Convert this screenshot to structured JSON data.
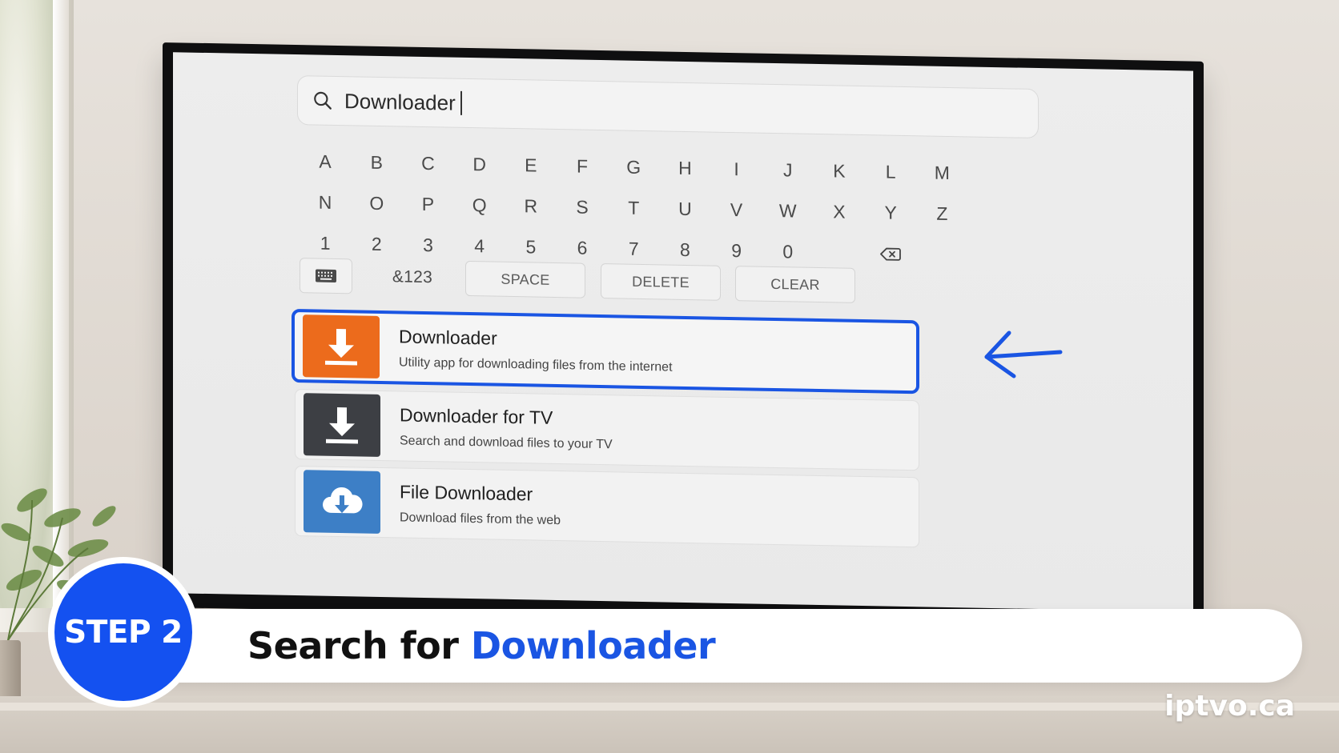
{
  "search": {
    "query": "Downloader"
  },
  "keyboard": {
    "rows": [
      [
        "A",
        "B",
        "C",
        "D",
        "E",
        "F",
        "G",
        "H",
        "I",
        "J",
        "K",
        "L",
        "M"
      ],
      [
        "N",
        "O",
        "P",
        "Q",
        "R",
        "S",
        "T",
        "U",
        "V",
        "W",
        "X",
        "Y",
        "Z"
      ],
      [
        "1",
        "2",
        "3",
        "4",
        "5",
        "6",
        "7",
        "8",
        "9",
        "0"
      ]
    ],
    "backspace_icon": "backspace-icon",
    "actions": {
      "keyboard_icon": "keyboard-icon",
      "symbols": "&123",
      "space": "SPACE",
      "delete": "DELETE",
      "clear": "CLEAR"
    }
  },
  "results": [
    {
      "title": "Downloader",
      "subtitle": "Utility app for downloading files from the internet",
      "icon": "download-arrow-icon",
      "icon_bg": "#ec6b1c",
      "selected": true
    },
    {
      "title": "Downloader for TV",
      "subtitle": "Search and download files to your TV",
      "icon": "download-arrow-icon",
      "icon_bg": "#3d3f44",
      "selected": false
    },
    {
      "title": "File Downloader",
      "subtitle": "Download files from the web",
      "icon": "cloud-download-icon",
      "icon_bg": "#3d7fc6",
      "selected": false
    }
  ],
  "banner": {
    "step": "STEP 2",
    "text_prefix": "Search for ",
    "text_highlight": "Downloader"
  },
  "brand": "iptvo.ca",
  "colors": {
    "accent": "#1a55e3",
    "step_circle": "#1451f0"
  }
}
